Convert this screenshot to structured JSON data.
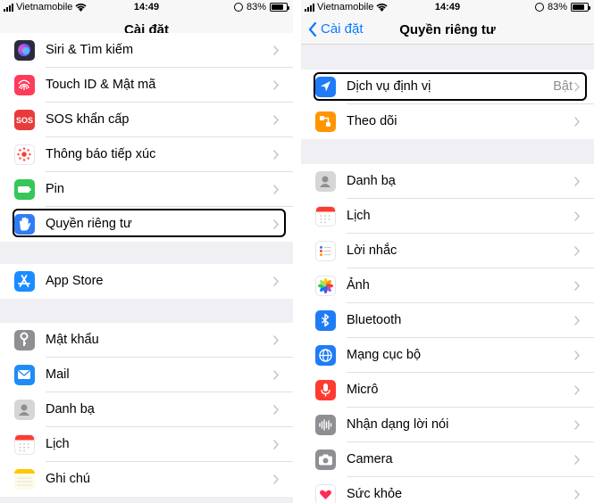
{
  "left": {
    "status": {
      "carrier": "Vietnamobile",
      "time": "14:49",
      "battery": "83%",
      "battery_level": 0.83
    },
    "title": "Cài đặt",
    "groups": [
      [
        {
          "label": "Siri & Tìm kiếm",
          "icon": "siri-icon",
          "color": "#2b2b3d"
        },
        {
          "label": "Touch ID & Mật mã",
          "icon": "fingerprint-icon",
          "color": "#ff3b5c"
        },
        {
          "label": "SOS khẩn cấp",
          "icon": "sos-icon",
          "color": "#e83b3b",
          "icon_text": "SOS"
        },
        {
          "label": "Thông báo tiếp xúc",
          "icon": "exposure-notification-icon",
          "color": "#ffffff"
        },
        {
          "label": "Pin",
          "icon": "battery-icon",
          "color": "#35c759"
        },
        {
          "label": "Quyền riêng tư",
          "icon": "privacy-hand-icon",
          "color": "#2f7cf6",
          "highlighted": true
        }
      ],
      [
        {
          "label": "App Store",
          "icon": "app-store-icon",
          "color": "#1a8cff"
        }
      ],
      [
        {
          "label": "Mật khẩu",
          "icon": "key-icon",
          "color": "#8e8e93"
        },
        {
          "label": "Mail",
          "icon": "mail-icon",
          "color": "#1f8cf5"
        },
        {
          "label": "Danh bạ",
          "icon": "contacts-icon",
          "color": "#d6d6d6"
        },
        {
          "label": "Lịch",
          "icon": "calendar-icon",
          "color": "#ffffff"
        },
        {
          "label": "Ghi chú",
          "icon": "notes-icon",
          "color": "#ffd43b"
        }
      ]
    ]
  },
  "right": {
    "status": {
      "carrier": "Vietnamobile",
      "time": "14:49",
      "battery": "83%",
      "battery_level": 0.83
    },
    "back_label": "Cài đặt",
    "title": "Quyền riêng tư",
    "groups": [
      [
        {
          "label": "Dịch vụ định vị",
          "icon": "location-icon",
          "color": "#1f7cf6",
          "value": "Bật",
          "highlighted": true
        },
        {
          "label": "Theo dõi",
          "icon": "tracking-icon",
          "color": "#ff9500"
        }
      ],
      [
        {
          "label": "Danh bạ",
          "icon": "contacts-icon",
          "color": "#d6d6d6"
        },
        {
          "label": "Lịch",
          "icon": "calendar-icon",
          "color": "#ffffff"
        },
        {
          "label": "Lời nhắc",
          "icon": "reminders-icon",
          "color": "#ffffff"
        },
        {
          "label": "Ảnh",
          "icon": "photos-icon",
          "color": "#ffffff"
        },
        {
          "label": "Bluetooth",
          "icon": "bluetooth-icon",
          "color": "#1f7cf6"
        },
        {
          "label": "Mạng cục bộ",
          "icon": "local-network-icon",
          "color": "#1f7cf6"
        },
        {
          "label": "Micrô",
          "icon": "microphone-icon",
          "color": "#ff3b30"
        },
        {
          "label": "Nhận dạng lời nói",
          "icon": "speech-recognition-icon",
          "color": "#8e8e93"
        },
        {
          "label": "Camera",
          "icon": "camera-icon",
          "color": "#8e8e93"
        },
        {
          "label": "Sức khỏe",
          "icon": "health-icon",
          "color": "#ffffff"
        }
      ]
    ]
  }
}
